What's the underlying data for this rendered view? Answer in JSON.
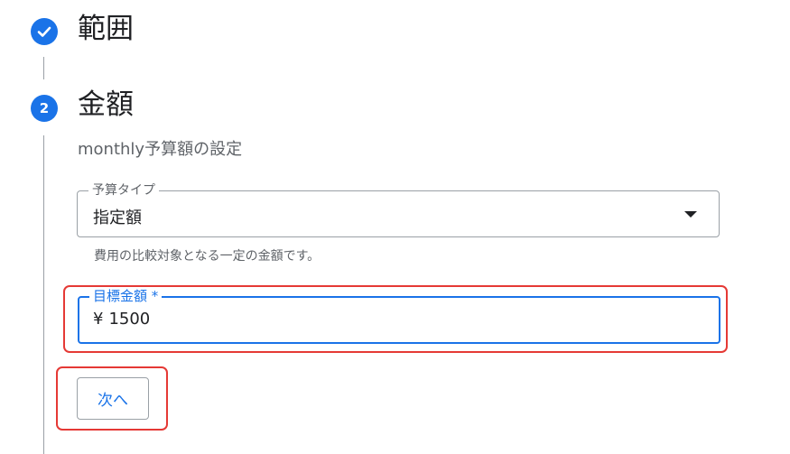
{
  "steps": [
    {
      "title": "範囲",
      "state": "completed",
      "icon": "check-icon"
    },
    {
      "number": "2",
      "title": "金額",
      "state": "active",
      "subtitle": "monthly予算額の設定"
    }
  ],
  "budget_type": {
    "label": "予算タイプ",
    "value": "指定額",
    "helper": "費用の比較対象となる一定の金額です。"
  },
  "target_amount": {
    "label": "目標金額 *",
    "currency": "¥",
    "value": "1500"
  },
  "next_button": {
    "label": "次へ"
  },
  "colors": {
    "accent": "#1a73e8",
    "highlight": "#e53935",
    "text": "#202124",
    "muted": "#5f6368",
    "border": "#9aa0a6"
  }
}
